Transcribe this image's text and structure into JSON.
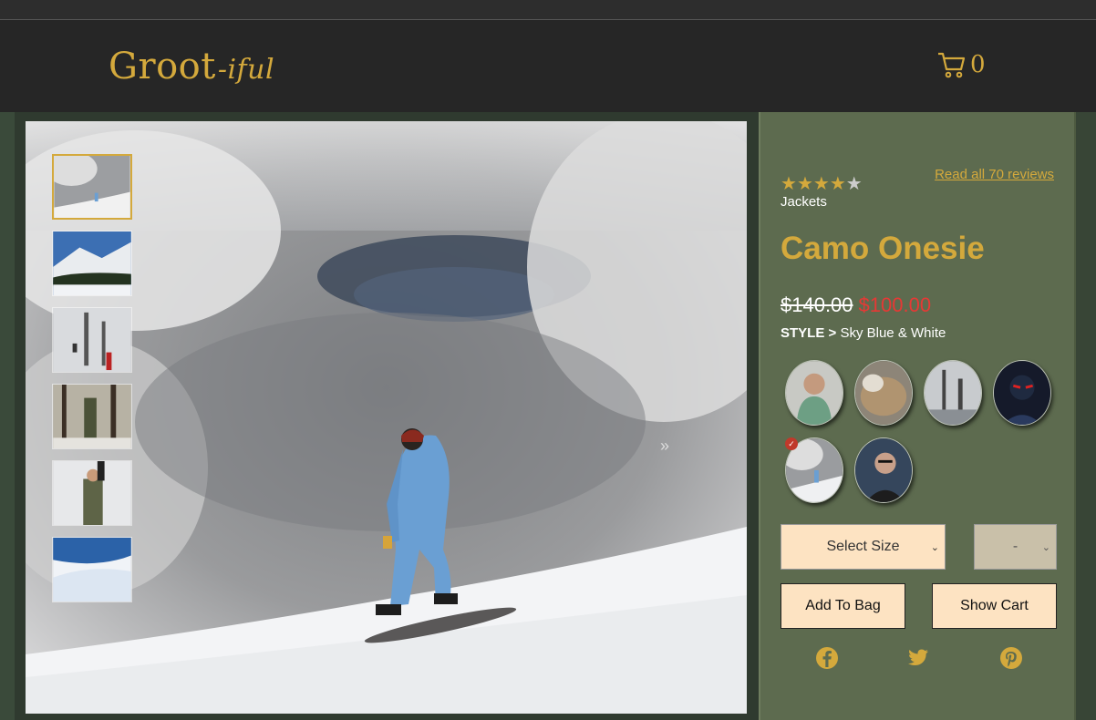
{
  "brand": {
    "name": "Groot",
    "suffix": "-iful"
  },
  "cart": {
    "count": "0"
  },
  "gallery": {
    "next_label": "»",
    "thumbnails": [
      "snow-clouds",
      "mountain-snowboarder",
      "ski-lift",
      "forest-winter",
      "camo-man-snow",
      "snow-slope"
    ]
  },
  "product": {
    "rating_stars": [
      "★",
      "★",
      "★",
      "★",
      "★"
    ],
    "rating": 4,
    "category": "Jackets",
    "reviews_link": "Read all 70 reviews",
    "name": "Camo Onesie",
    "old_price": "$140.00",
    "new_price": "$100.00",
    "style_label": "STYLE >",
    "style_value": "Sky Blue & White",
    "size_select": "Select Size",
    "qty_select": "-",
    "add_to_bag": "Add To Bag",
    "show_cart": "Show Cart"
  },
  "colors": {
    "accent": "#d4a93c",
    "sale": "#e53935",
    "panel": "#5d6b4f",
    "button": "#fde3c2"
  }
}
